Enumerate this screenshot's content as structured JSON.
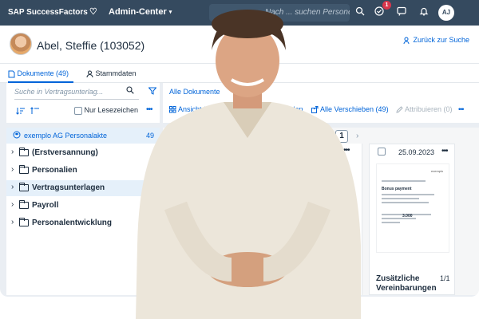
{
  "shell": {
    "logo": "SAP SuccessFactors",
    "logo_heart": "♡",
    "app_title": "Admin-Center",
    "app_caret": "▾",
    "search_placeholder": "Nach ... suchen Personen suchen",
    "notification_count": "1",
    "user_initials": "AJ"
  },
  "header": {
    "employee_name": "Abel, Steffie (103052)",
    "back_link": "Zurück zur Suche"
  },
  "tabs": [
    {
      "label": "Dokumente (49)",
      "active": true
    },
    {
      "label": "Stammdaten",
      "active": false
    }
  ],
  "left_toolbar": {
    "search_placeholder": "Suche in Vertragsunterlag...",
    "bookmarks_label": "Nur Lesezeichen",
    "more": "•••"
  },
  "tree": {
    "header_label": "exemplo AG Personalakte",
    "header_count": "49",
    "folders": [
      {
        "label": "(Erstversannung)",
        "selected": false
      },
      {
        "label": "Personalien",
        "selected": false
      },
      {
        "label": "Vertragsunterlagen",
        "selected": true
      },
      {
        "label": "Payroll",
        "selected": false
      },
      {
        "label": "Personalentwicklung",
        "selected": false
      }
    ]
  },
  "right_toolbar": {
    "breadcrumb": "Alle Dokumente",
    "actions": [
      {
        "label": "Ansicht änd",
        "enabled": true
      },
      {
        "label": "chladen",
        "enabled": true
      },
      {
        "label": "Alle Verschieben (49)",
        "enabled": true
      },
      {
        "label": "Attribuieren (0)",
        "enabled": false
      }
    ],
    "more": "•••"
  },
  "pager": {
    "current_page": "1",
    "next": "›"
  },
  "document_card": {
    "date": "25.09.2023",
    "more": "•••",
    "title": "Zusätzliche Vereinbarungen",
    "page_indicator": "1/1",
    "thumb_brand": "exemplo",
    "thumb_heading": "Bonus payment",
    "thumb_amount": "3.000"
  },
  "colors": {
    "shell": "#354a5f",
    "accent": "#0064d9",
    "selected_row": "#e5f0fa",
    "badge": "#d9364c"
  }
}
